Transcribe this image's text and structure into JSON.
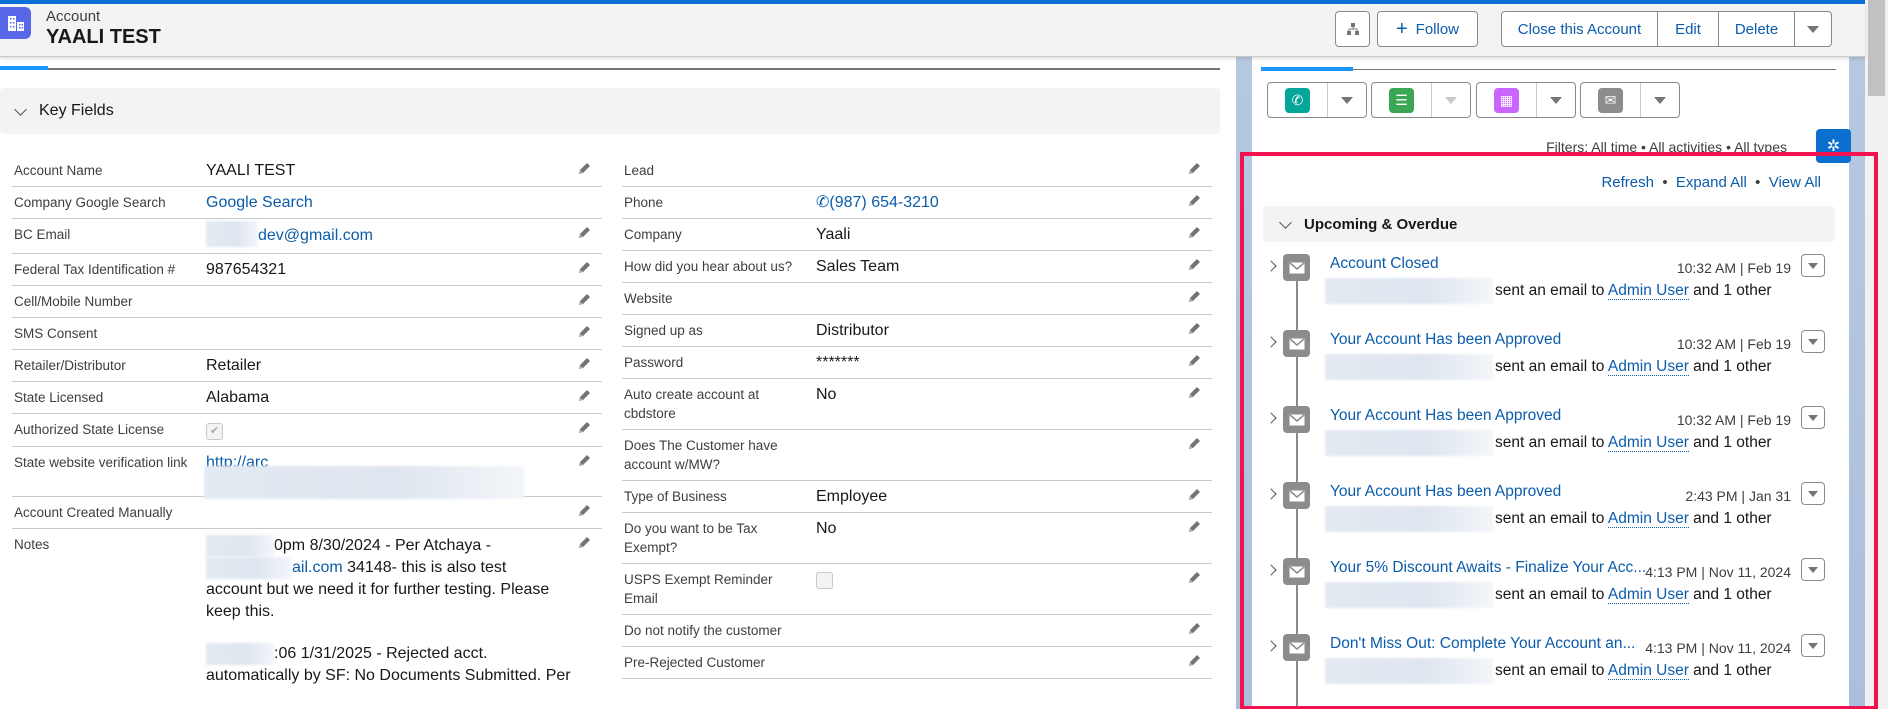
{
  "header": {
    "object_type": "Account",
    "record_name": "YAALI TEST",
    "follow_label": "Follow",
    "actions": [
      "Close this Account",
      "Edit",
      "Delete"
    ]
  },
  "key_fields": {
    "title": "Key Fields",
    "left": [
      {
        "label": "Account Name",
        "value": "YAALI TEST",
        "type": "text",
        "editable": true
      },
      {
        "label": "Company Google Search",
        "value": "Google Search",
        "type": "link",
        "editable": false
      },
      {
        "label": "BC Email",
        "value": "dev@gmail.com",
        "type": "email",
        "editable": true
      },
      {
        "label": "Federal Tax Identification #",
        "value": "987654321",
        "type": "text",
        "editable": true
      },
      {
        "label": "Cell/Mobile Number",
        "value": "",
        "type": "text",
        "editable": true
      },
      {
        "label": "SMS Consent",
        "value": "",
        "type": "text",
        "editable": true
      },
      {
        "label": "Retailer/Distributor",
        "value": "Retailer",
        "type": "text",
        "editable": true
      },
      {
        "label": "State Licensed",
        "value": "Alabama",
        "type": "text",
        "editable": true
      },
      {
        "label": "Authorized State License",
        "value": true,
        "type": "checkbox",
        "editable": true
      },
      {
        "label": "State website verification link",
        "value": "http://arc",
        "type": "redacted-link",
        "editable": true
      },
      {
        "label": "Account Created Manually",
        "value": "",
        "type": "text",
        "editable": true
      }
    ],
    "notes": {
      "label": "Notes",
      "line1": "0pm 8/30/2024 - Per Atchaya -",
      "line2_link": "ail.com",
      "line2_rest": " 34148- this is also test",
      "line3": "account but we need it for further testing. Please",
      "line4": "keep this.",
      "line5": ":06 1/31/2025 - Rejected acct.",
      "line6": "automatically by SF: No Documents Submitted. Per"
    },
    "right": [
      {
        "label": "Lead",
        "value": "",
        "type": "text",
        "editable": true
      },
      {
        "label": "Phone",
        "value": "(987) 654-3210",
        "type": "phone",
        "editable": true
      },
      {
        "label": "Company",
        "value": "Yaali",
        "type": "text",
        "editable": true
      },
      {
        "label": "How did you hear about us?",
        "value": "Sales Team",
        "type": "text",
        "editable": true
      },
      {
        "label": "Website",
        "value": "",
        "type": "text",
        "editable": true
      },
      {
        "label": "Signed up as",
        "value": "Distributor",
        "type": "text",
        "editable": true
      },
      {
        "label": "Password",
        "value": "*******",
        "type": "text",
        "editable": true
      },
      {
        "label": "Auto create account at cbdstore",
        "value": "No",
        "type": "text",
        "editable": true
      },
      {
        "label": "Does The Customer have account w/MW?",
        "value": "",
        "type": "text",
        "editable": true
      },
      {
        "label": "Type of Business",
        "value": "Employee",
        "type": "text",
        "editable": true
      },
      {
        "label": "Do you want to be Tax Exempt?",
        "value": "No",
        "type": "text",
        "editable": true
      },
      {
        "label": "USPS Exempt Reminder Email",
        "value": false,
        "type": "checkbox",
        "editable": true
      },
      {
        "label": "Do not notify the customer",
        "value": "",
        "type": "text",
        "editable": true
      },
      {
        "label": "Pre-Rejected Customer",
        "value": "",
        "type": "text",
        "editable": true
      }
    ]
  },
  "activity": {
    "filters": "Filters: All time • All activities • All types",
    "links": [
      "Refresh",
      "Expand All",
      "View All"
    ],
    "section_title": "Upcoming & Overdue",
    "items": [
      {
        "title": "Account Closed",
        "time": "10:32 AM | Feb 19",
        "sent": "sent an email to",
        "recipient": "Admin User",
        "others": "and 1 other"
      },
      {
        "title": "Your Account Has been Approved",
        "time": "10:32 AM | Feb 19",
        "sent": "sent an email to",
        "recipient": "Admin User",
        "others": "and 1 other"
      },
      {
        "title": "Your Account Has been Approved",
        "time": "10:32 AM | Feb 19",
        "sent": "sent an email to",
        "recipient": "Admin User",
        "others": "and 1 other"
      },
      {
        "title": "Your Account Has been Approved",
        "time": "2:43 PM | Jan 31",
        "sent": "sent an email to",
        "recipient": "Admin User",
        "others": "and 1 other"
      },
      {
        "title": "Your 5% Discount Awaits - Finalize Your Acc...",
        "time": "4:13 PM | Nov 11, 2024",
        "sent": "sent an email to",
        "recipient": "Admin User",
        "others": "and 1 other"
      },
      {
        "title": "Don't Miss Out: Complete Your Account an...",
        "time": "4:13 PM | Nov 11, 2024",
        "sent": "sent an email to",
        "recipient": "Admin User",
        "others": "and 1 other"
      }
    ]
  },
  "colors": {
    "brand": "#0b5cab",
    "highlight_box": "#f2124f",
    "account_icon": "#5867e8"
  }
}
